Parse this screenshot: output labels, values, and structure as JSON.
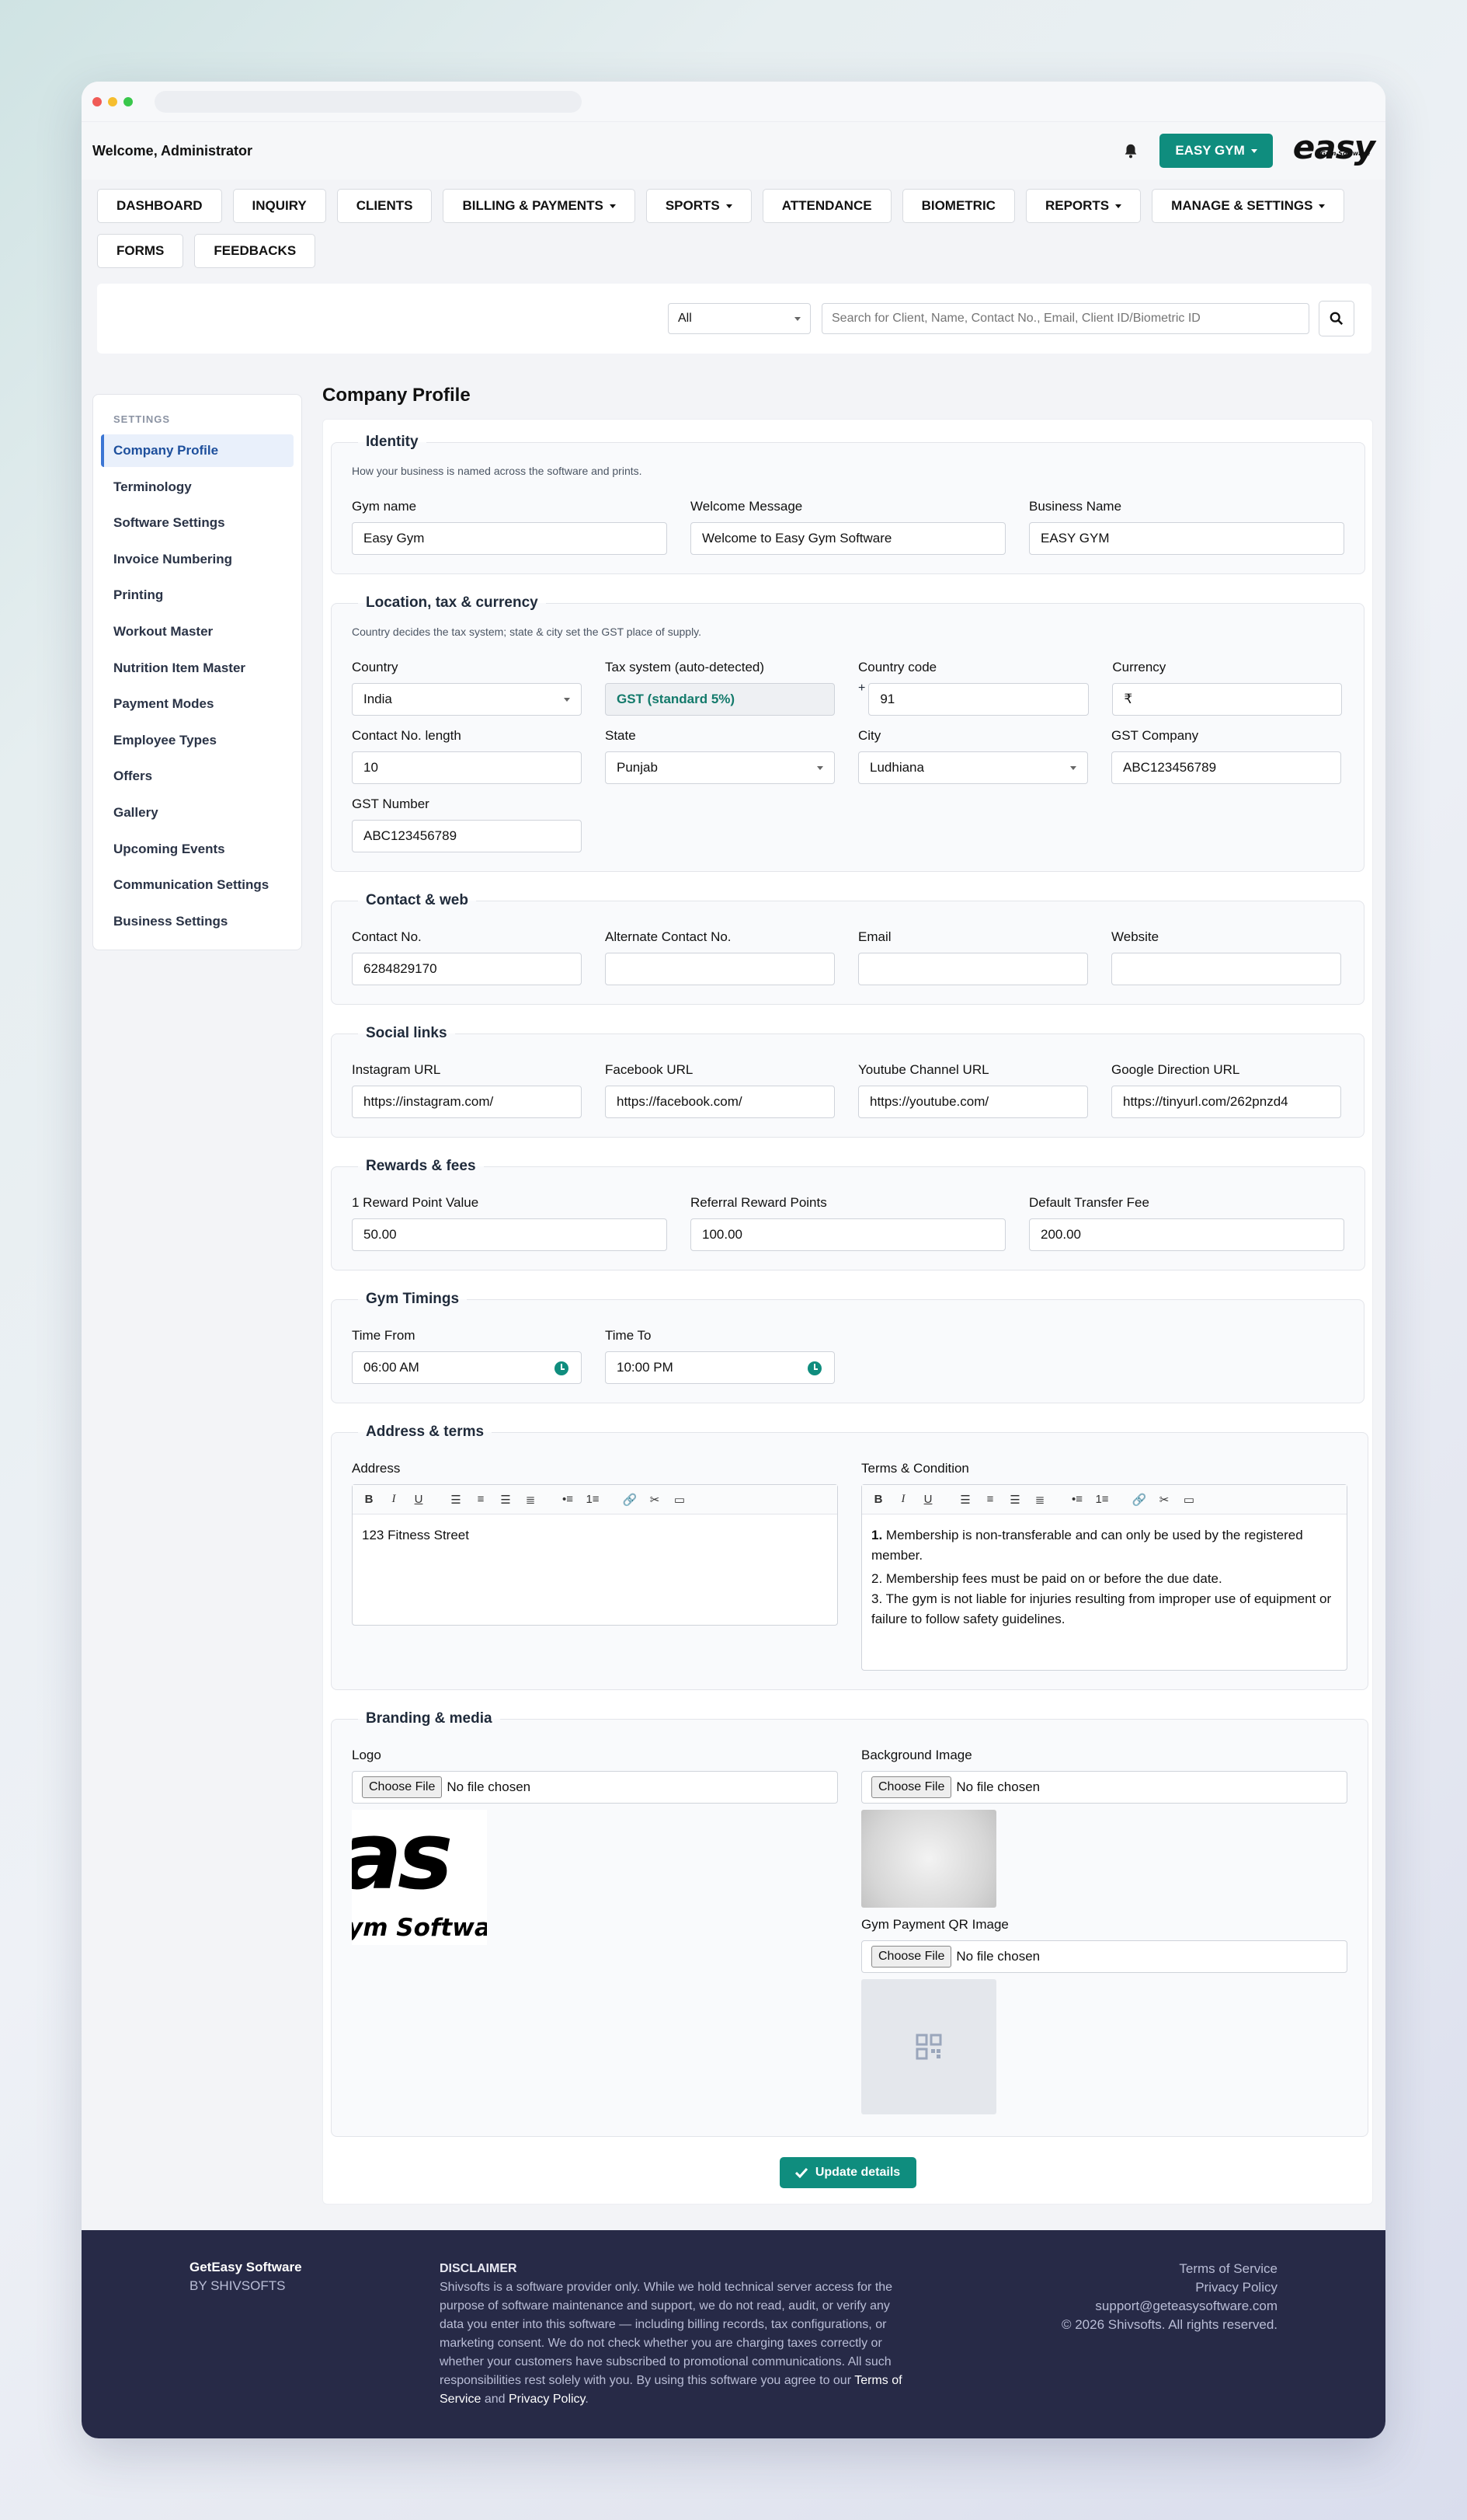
{
  "header": {
    "welcome": "Welcome, Administrator",
    "gym_button": "EASY GYM",
    "logo_text": "easy",
    "logo_sub": "Gym Software"
  },
  "nav": [
    "DASHBOARD",
    "INQUIRY",
    "CLIENTS",
    "BILLING & PAYMENTS",
    "SPORTS",
    "ATTENDANCE",
    "BIOMETRIC",
    "REPORTS",
    "MANAGE & SETTINGS",
    "FORMS",
    "FEEDBACKS"
  ],
  "nav_dropdown": [
    false,
    false,
    false,
    true,
    true,
    false,
    false,
    true,
    true,
    false,
    false
  ],
  "search": {
    "filter": "All",
    "placeholder": "Search for Client, Name, Contact No., Email, Client ID/Biometric ID"
  },
  "sidebar": {
    "section": "SETTINGS",
    "items": [
      "Company Profile",
      "Terminology",
      "Software Settings",
      "Invoice Numbering",
      "Printing",
      "Workout Master",
      "Nutrition Item Master",
      "Payment Modes",
      "Employee Types",
      "Offers",
      "Gallery",
      "Upcoming Events",
      "Communication Settings",
      "Business Settings"
    ]
  },
  "page_title": "Company Profile",
  "identity": {
    "legend": "Identity",
    "hint": "How your business is named across the software and prints.",
    "gym_name_label": "Gym name",
    "gym_name": "Easy Gym",
    "welcome_label": "Welcome Message",
    "welcome": "Welcome to Easy Gym Software",
    "business_label": "Business Name",
    "business": "EASY GYM"
  },
  "location": {
    "legend": "Location, tax & currency",
    "hint": "Country decides the tax system; state & city set the GST place of supply.",
    "country_label": "Country",
    "country": "India",
    "tax_label": "Tax system (auto-detected)",
    "tax": "GST (standard 5%)",
    "code_label": "Country code",
    "code_prefix": "+",
    "code": "91",
    "currency_label": "Currency",
    "currency": "₹",
    "len_label": "Contact No. length",
    "len": "10",
    "state_label": "State",
    "state": "Punjab",
    "city_label": "City",
    "city": "Ludhiana",
    "gstco_label": "GST Company",
    "gstco": "ABC123456789",
    "gstno_label": "GST Number",
    "gstno": "ABC123456789"
  },
  "contact": {
    "legend": "Contact & web",
    "contact_label": "Contact No.",
    "contact": "6284829170",
    "alt_label": "Alternate Contact No.",
    "alt": "",
    "email_label": "Email",
    "email": "",
    "website_label": "Website",
    "website": ""
  },
  "social": {
    "legend": "Social links",
    "ig_label": "Instagram URL",
    "ig": "https://instagram.com/",
    "fb_label": "Facebook URL",
    "fb": "https://facebook.com/",
    "yt_label": "Youtube Channel URL",
    "yt": "https://youtube.com/",
    "gd_label": "Google Direction URL",
    "gd": "https://tinyurl.com/262pnzd4"
  },
  "rewards": {
    "legend": "Rewards & fees",
    "rp_label": "1 Reward Point Value",
    "rp": "50.00",
    "ref_label": "Referral Reward Points",
    "ref": "100.00",
    "fee_label": "Default Transfer Fee",
    "fee": "200.00"
  },
  "timings": {
    "legend": "Gym Timings",
    "from_label": "Time From",
    "from": "06:00 AM",
    "to_label": "Time To",
    "to": "10:00 PM"
  },
  "address": {
    "legend": "Address & terms",
    "address_label": "Address",
    "address": "123 Fitness Street",
    "terms_label": "Terms & Condition",
    "terms_1_num": "1.",
    "terms_1": "Membership is non-transferable and can only be used by the registered member.",
    "terms_2": "2. Membership fees must be paid on or before the due date.",
    "terms_3": "3. The gym is not liable for injuries resulting from improper use of equipment or failure to follow safety guidelines."
  },
  "branding": {
    "legend": "Branding & media",
    "logo_label": "Logo",
    "bg_label": "Background Image",
    "qr_label": "Gym Payment QR Image",
    "choose": "Choose File",
    "no_file": "No file chosen",
    "logo_thumb_big": "as",
    "logo_thumb_small": "ym Softwa"
  },
  "update_button": "Update details",
  "footer": {
    "brand": "GetEasy Software",
    "by": "BY SHIVSOFTS",
    "disclaimer_title": "DISCLAIMER",
    "disclaimer": "Shivsofts is a software provider only. While we hold technical server access for the purpose of software maintenance and support, we do not read, audit, or verify any data you enter into this software — including billing records, tax configurations, or marketing consent. We do not check whether you are charging taxes correctly or whether your customers have subscribed to promotional communications. All such responsibilities rest solely with you. By using this software you agree to our",
    "tos_inline": "Terms of Service",
    "and": "and",
    "privacy_inline": "Privacy Policy",
    "dot": ".",
    "link_tos": "Terms of Service",
    "link_privacy": "Privacy Policy",
    "support": "support@geteasysoftware.com",
    "copyright": "© 2026 Shivsofts. All rights reserved."
  },
  "colors": {
    "accent": "#0f8d7e",
    "footer_bg": "#272a47",
    "active_item": "#1d4f9c"
  }
}
